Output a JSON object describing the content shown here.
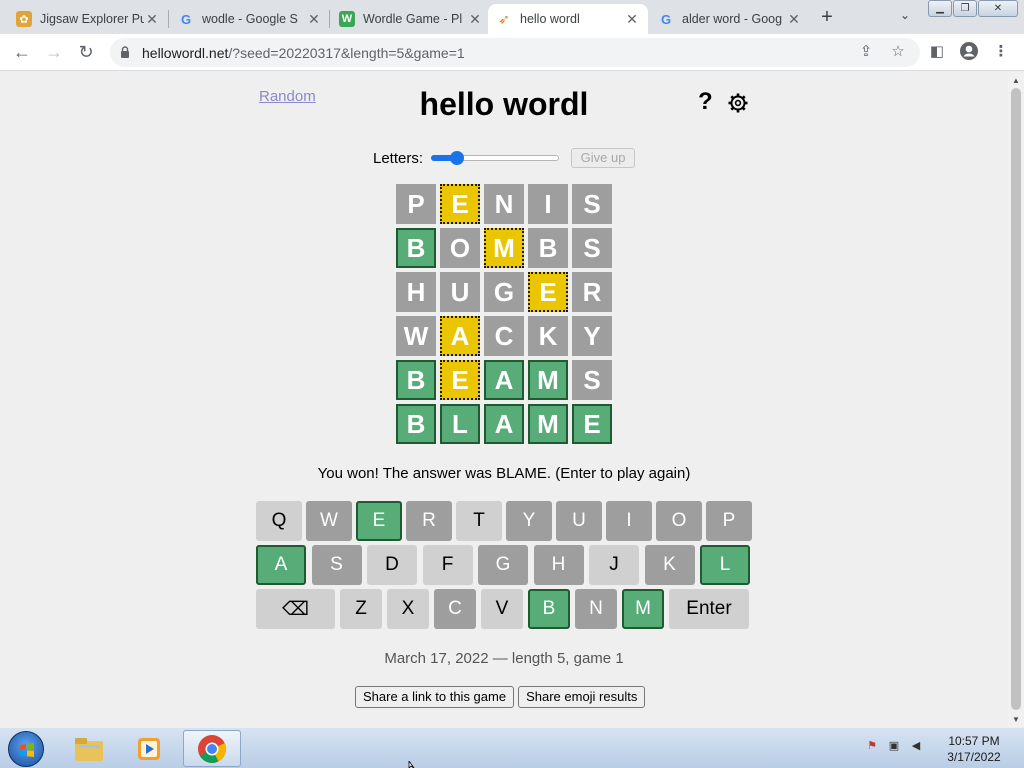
{
  "browser": {
    "tabs": [
      {
        "title": "Jigsaw Explorer Pu",
        "icon": "jigsaw-favicon-icon",
        "active": false
      },
      {
        "title": "wodle - Google S",
        "icon": "google-favicon-icon",
        "active": false
      },
      {
        "title": "Wordle Game - Pl",
        "icon": "wordle-favicon-icon",
        "active": false
      },
      {
        "title": "hello wordl",
        "icon": "hello-wordl-favicon-icon",
        "active": true
      },
      {
        "title": "alder word - Goog",
        "icon": "google-favicon-icon",
        "active": false
      }
    ],
    "url_domain": "hellowordl.net",
    "url_path": "/?seed=20220317&length=5&game=1"
  },
  "page": {
    "random_link": "Random",
    "title": "hello wordl",
    "help_label": "?",
    "letters_label": "Letters:",
    "letters_slider_fraction": 0.17,
    "give_up_label": "Give up",
    "win_message": "You won! The answer was BLAME. (Enter to play again)",
    "game_info": "March 17, 2022 — length 5, game 1",
    "share_link_label": "Share a link to this game",
    "share_emoji_label": "Share emoji results"
  },
  "board": [
    [
      {
        "l": "P",
        "s": "absent"
      },
      {
        "l": "E",
        "s": "present"
      },
      {
        "l": "N",
        "s": "absent"
      },
      {
        "l": "I",
        "s": "absent"
      },
      {
        "l": "S",
        "s": "absent"
      }
    ],
    [
      {
        "l": "B",
        "s": "correct"
      },
      {
        "l": "O",
        "s": "absent"
      },
      {
        "l": "M",
        "s": "present"
      },
      {
        "l": "B",
        "s": "absent"
      },
      {
        "l": "S",
        "s": "absent"
      }
    ],
    [
      {
        "l": "H",
        "s": "absent"
      },
      {
        "l": "U",
        "s": "absent"
      },
      {
        "l": "G",
        "s": "absent"
      },
      {
        "l": "E",
        "s": "present"
      },
      {
        "l": "R",
        "s": "absent"
      }
    ],
    [
      {
        "l": "W",
        "s": "absent"
      },
      {
        "l": "A",
        "s": "present"
      },
      {
        "l": "C",
        "s": "absent"
      },
      {
        "l": "K",
        "s": "absent"
      },
      {
        "l": "Y",
        "s": "absent"
      }
    ],
    [
      {
        "l": "B",
        "s": "correct"
      },
      {
        "l": "E",
        "s": "present"
      },
      {
        "l": "A",
        "s": "correct"
      },
      {
        "l": "M",
        "s": "correct"
      },
      {
        "l": "S",
        "s": "absent"
      }
    ],
    [
      {
        "l": "B",
        "s": "correct"
      },
      {
        "l": "L",
        "s": "correct"
      },
      {
        "l": "A",
        "s": "correct"
      },
      {
        "l": "M",
        "s": "correct"
      },
      {
        "l": "E",
        "s": "correct"
      }
    ]
  ],
  "keyboard": [
    [
      {
        "k": "Q",
        "s": "unused"
      },
      {
        "k": "W",
        "s": "absent"
      },
      {
        "k": "E",
        "s": "correct"
      },
      {
        "k": "R",
        "s": "absent"
      },
      {
        "k": "T",
        "s": "unused"
      },
      {
        "k": "Y",
        "s": "absent"
      },
      {
        "k": "U",
        "s": "absent"
      },
      {
        "k": "I",
        "s": "absent"
      },
      {
        "k": "O",
        "s": "absent"
      },
      {
        "k": "P",
        "s": "absent"
      }
    ],
    [
      {
        "k": "A",
        "s": "correct"
      },
      {
        "k": "S",
        "s": "absent"
      },
      {
        "k": "D",
        "s": "unused"
      },
      {
        "k": "F",
        "s": "unused"
      },
      {
        "k": "G",
        "s": "absent"
      },
      {
        "k": "H",
        "s": "absent"
      },
      {
        "k": "J",
        "s": "unused"
      },
      {
        "k": "K",
        "s": "absent"
      },
      {
        "k": "L",
        "s": "correct"
      }
    ],
    [
      {
        "k": "⌫",
        "s": "unused",
        "name": "backspace"
      },
      {
        "k": "Z",
        "s": "unused"
      },
      {
        "k": "X",
        "s": "unused"
      },
      {
        "k": "C",
        "s": "absent"
      },
      {
        "k": "V",
        "s": "unused"
      },
      {
        "k": "B",
        "s": "correct"
      },
      {
        "k": "N",
        "s": "absent"
      },
      {
        "k": "M",
        "s": "correct"
      },
      {
        "k": "Enter",
        "s": "unused",
        "name": "enter"
      }
    ]
  ],
  "taskbar": {
    "clock_time": "10:57 PM",
    "clock_date": "3/17/2022"
  },
  "colors": {
    "correct": "#57ac78",
    "present": "#e9c601",
    "absent": "#9e9e9e",
    "unused": "#d0d0d0",
    "slider": "#1a73e8"
  }
}
